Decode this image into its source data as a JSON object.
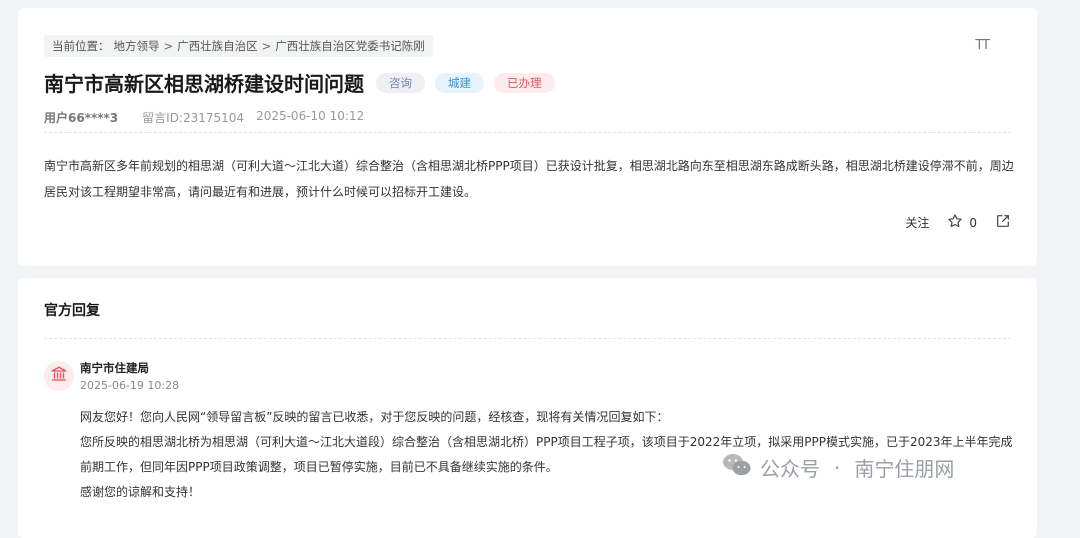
{
  "breadcrumb": {
    "prefix": "当前位置：",
    "items": [
      "地方领导",
      "广西壮族自治区",
      "广西壮族自治区党委书记陈刚"
    ],
    "separator": ">"
  },
  "font_size_label": "TT",
  "message": {
    "title": "南宁市高新区相思湖桥建设时间问题",
    "tags": [
      {
        "label": "咨询",
        "color": "#7a86a8"
      },
      {
        "label": "城建",
        "color": "#3f8fd0"
      },
      {
        "label": "已办理",
        "color": "#e05562"
      }
    ],
    "user": "用户66****3",
    "id": "留言ID:23175104",
    "time": "2025-06-10 10:12",
    "content": "南宁市高新区多年前规划的相思湖（可利大道～江北大道）综合整治（含相思湖北桥PPP项目）已获设计批复，相思湖北路向东至相思湖东路成断头路，相思湖北桥建设停滞不前，周边居民对该工程期望非常高，请问最近有和进展，预计什么时候可以招标开工建设。",
    "follow_label": "关注",
    "star_count": "0"
  },
  "reply": {
    "header": "官方回复",
    "department": "南宁市住建局",
    "time": "2025-06-19 10:28",
    "paragraphs": [
      "网友您好！您向人民网“领导留言板”反映的留言已收悉，对于您反映的问题，经核查，现将有关情况回复如下：",
      "您所反映的相思湖北桥为相思湖（可利大道～江北大道段）综合整治（含相思湖北桥）PPP项目工程子项，该项目于2022年立项，拟采用PPP模式实施，已于2023年上半年完成前期工作，但同年因PPP项目政策调整，项目已暂停实施，目前已不具备继续实施的条件。",
      "感谢您的谅解和支持！"
    ]
  },
  "watermark": {
    "label": "公众号",
    "dot": "·",
    "name": "南宁住朋网"
  },
  "colors": {
    "accent_red": "#e05562",
    "accent_blue": "#3f8fd0",
    "background": "#f3f4f6"
  }
}
